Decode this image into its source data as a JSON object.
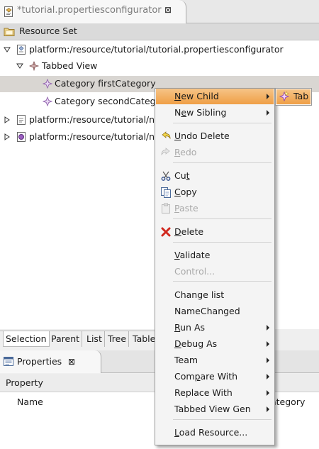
{
  "editor_tab": {
    "title": "*tutorial.propertiesconfigurator",
    "close_glyph": "⊠"
  },
  "resource_set": {
    "label": "Resource Set"
  },
  "tree": {
    "rows": [
      {
        "label": "platform:/resource/tutorial/tutorial.propertiesconfigurator"
      },
      {
        "label": "Tabbed View"
      },
      {
        "label": "Category firstCategory"
      },
      {
        "label": "Category secondCateg"
      },
      {
        "label": "platform:/resource/tutorial/n"
      },
      {
        "label": "platform:/resource/tutorial/n"
      }
    ]
  },
  "editor_bottom_tabs": [
    "Selection",
    "Parent",
    "List",
    "Tree",
    "Table"
  ],
  "properties": {
    "tab_title": "Properties",
    "close_glyph": "⊠",
    "column_header": "Property",
    "row_name": "Name",
    "row_value": "ategory"
  },
  "context_menu": {
    "items": [
      {
        "label": "New Child",
        "mnemonic": "N",
        "icon": "",
        "submenu": true,
        "disabled": false,
        "highlighted": true
      },
      {
        "label": "New Sibling",
        "mnemonic": "e",
        "icon": "",
        "submenu": true,
        "disabled": false
      },
      {
        "label": "Undo Delete",
        "mnemonic": "U",
        "icon": "undo-icon",
        "submenu": false,
        "disabled": false
      },
      {
        "label": "Redo",
        "mnemonic": "R",
        "icon": "redo-icon",
        "submenu": false,
        "disabled": true
      },
      {
        "label": "Cut",
        "mnemonic": "t",
        "icon": "cut-icon",
        "submenu": false,
        "disabled": false
      },
      {
        "label": "Copy",
        "mnemonic": "C",
        "icon": "copy-icon",
        "submenu": false,
        "disabled": false
      },
      {
        "label": "Paste",
        "mnemonic": "P",
        "icon": "paste-icon",
        "submenu": false,
        "disabled": true
      },
      {
        "label": "Delete",
        "mnemonic": "D",
        "icon": "delete-icon",
        "submenu": false,
        "disabled": false
      },
      {
        "label": "Validate",
        "mnemonic": "V",
        "icon": "",
        "submenu": false,
        "disabled": false
      },
      {
        "label": "Control...",
        "mnemonic": "",
        "icon": "",
        "submenu": false,
        "disabled": true
      },
      {
        "label": "Change list",
        "mnemonic": "",
        "icon": "",
        "submenu": false,
        "disabled": false
      },
      {
        "label": "NameChanged",
        "mnemonic": "",
        "icon": "",
        "submenu": false,
        "disabled": false
      },
      {
        "label": "Run As",
        "mnemonic": "R",
        "icon": "",
        "submenu": true,
        "disabled": false
      },
      {
        "label": "Debug As",
        "mnemonic": "D",
        "icon": "",
        "submenu": true,
        "disabled": false
      },
      {
        "label": "Team",
        "mnemonic": "",
        "icon": "",
        "submenu": true,
        "disabled": false
      },
      {
        "label": "Compare With",
        "mnemonic": "p",
        "icon": "",
        "submenu": true,
        "disabled": false
      },
      {
        "label": "Replace With",
        "mnemonic": "",
        "icon": "",
        "submenu": true,
        "disabled": false
      },
      {
        "label": "Tabbed View Gen",
        "mnemonic": "",
        "icon": "",
        "submenu": true,
        "disabled": false
      },
      {
        "label": "Load Resource...",
        "mnemonic": "L",
        "icon": "",
        "submenu": false,
        "disabled": false
      }
    ]
  },
  "submenu": {
    "items": [
      {
        "label": "Tab",
        "icon": "tab-child-icon"
      }
    ]
  },
  "colors": {
    "highlight": "#f0a850",
    "selection_row": "#d9d6d2",
    "menu_bg": "#f4f4f4",
    "disabled_text": "#a9a9a9"
  }
}
